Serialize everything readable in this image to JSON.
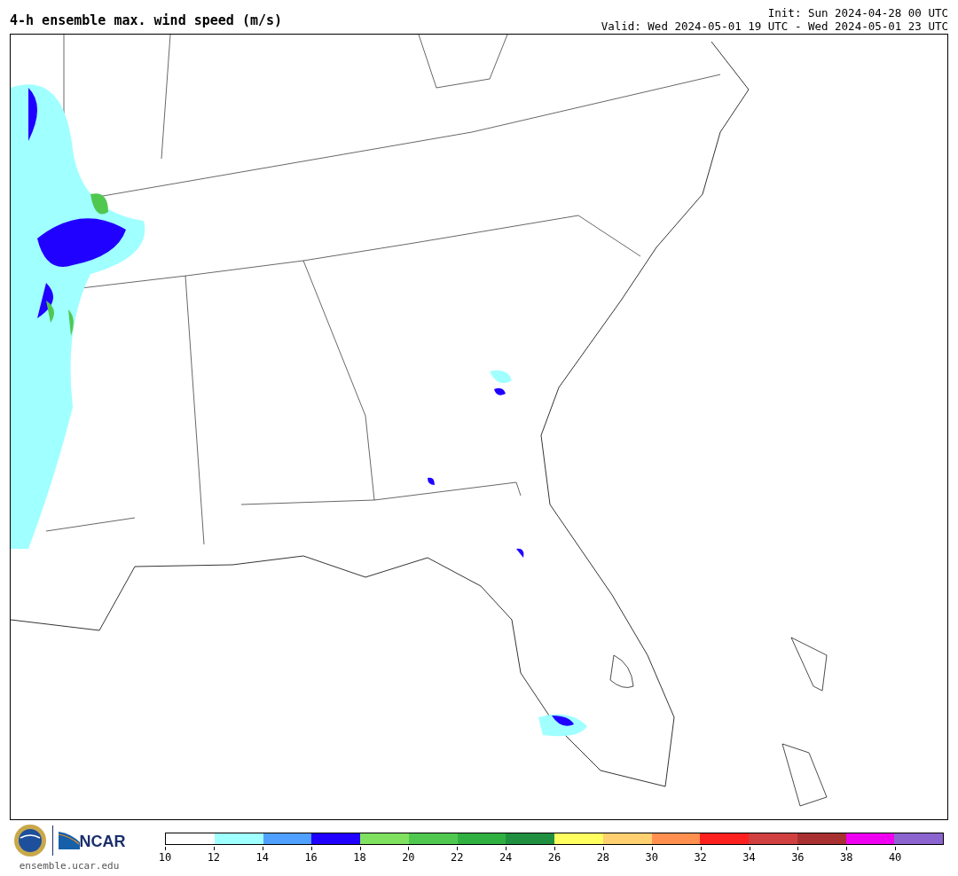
{
  "title": "4-h ensemble max. wind speed (m/s)",
  "init": "Init: Sun 2024-04-28 00 UTC",
  "valid": "Valid: Wed 2024-05-01 19 UTC - Wed 2024-05-01 23 UTC",
  "footer": {
    "logo_text": "NCAR",
    "site": "ensemble.ucar.edu"
  },
  "colorbar": {
    "segments": [
      {
        "color": "#ffffff"
      },
      {
        "color": "#a0ffff"
      },
      {
        "color": "#50a0ff"
      },
      {
        "color": "#2000ff"
      },
      {
        "color": "#80e060"
      },
      {
        "color": "#50c850"
      },
      {
        "color": "#30b040"
      },
      {
        "color": "#209040"
      },
      {
        "color": "#ffff60"
      },
      {
        "color": "#ffd070"
      },
      {
        "color": "#ff9050"
      },
      {
        "color": "#ff2020"
      },
      {
        "color": "#d04040"
      },
      {
        "color": "#a83030"
      },
      {
        "color": "#f000f0"
      },
      {
        "color": "#8c64d0"
      }
    ],
    "ticks": [
      "10",
      "12",
      "14",
      "16",
      "18",
      "20",
      "22",
      "24",
      "26",
      "28",
      "30",
      "32",
      "34",
      "36",
      "38",
      "40"
    ]
  }
}
